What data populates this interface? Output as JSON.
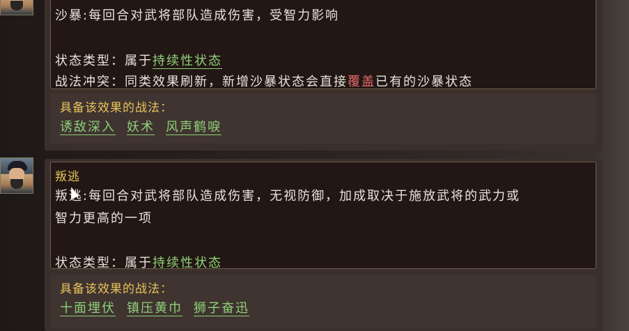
{
  "entries": [
    {
      "name": "",
      "description": "沙暴:每回合对武将部队造成伤害，受智力影响",
      "status_label": "状态类型：",
      "status_prefix": "属于",
      "status_value": "持续性状态",
      "conflict_label": "战法冲突：",
      "conflict_prefix": "同类效果刷新，新增沙暴状态会直接",
      "conflict_red": "覆盖",
      "conflict_suffix": "已有的沙暴状态",
      "tactics_title": "具备该效果的战法：",
      "tactics": [
        "诱敌深入",
        "妖术",
        "风声鹤唳"
      ]
    },
    {
      "name": "叛逃",
      "description_line1": "叛逃:每回合对武将部队造成伤害，无视防御，加成取决于施放武将的武力或",
      "description_line2": "智力更高的一项",
      "status_label": "状态类型：",
      "status_prefix": "属于",
      "status_value": "持续性状态",
      "tactics_title": "具备该效果的战法：",
      "tactics": [
        "十面埋伏",
        "镇压黄巾",
        "狮子奋迅"
      ]
    }
  ]
}
